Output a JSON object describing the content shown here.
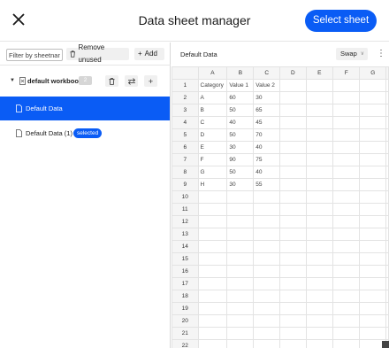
{
  "header": {
    "title": "Data sheet manager",
    "select_label": "Select sheet"
  },
  "toolbar": {
    "filter_placeholder": "Filter by sheetname",
    "remove_label": "Remove unused",
    "add_label": "Add"
  },
  "workbook": {
    "name": "default workbook",
    "badge": "2"
  },
  "sheets": [
    {
      "label": "Default Data",
      "active": true
    },
    {
      "label": "Default Data (1)",
      "badge": "selected"
    }
  ],
  "sheet_view": {
    "title": "Default Data",
    "swap_label": "Swap"
  },
  "grid": {
    "columns": [
      "A",
      "B",
      "C",
      "D",
      "E",
      "F",
      "G"
    ],
    "rows": [
      [
        "Category",
        "Value 1",
        "Value 2",
        "",
        "",
        "",
        ""
      ],
      [
        "A",
        "60",
        "30",
        "",
        "",
        "",
        ""
      ],
      [
        "B",
        "50",
        "65",
        "",
        "",
        "",
        ""
      ],
      [
        "C",
        "40",
        "45",
        "",
        "",
        "",
        ""
      ],
      [
        "D",
        "50",
        "70",
        "",
        "",
        "",
        ""
      ],
      [
        "E",
        "30",
        "40",
        "",
        "",
        "",
        ""
      ],
      [
        "F",
        "90",
        "75",
        "",
        "",
        "",
        ""
      ],
      [
        "G",
        "50",
        "40",
        "",
        "",
        "",
        ""
      ],
      [
        "H",
        "30",
        "55",
        "",
        "",
        "",
        ""
      ]
    ],
    "row_count": 22
  },
  "colors": {
    "accent": "#0a5cf5"
  }
}
